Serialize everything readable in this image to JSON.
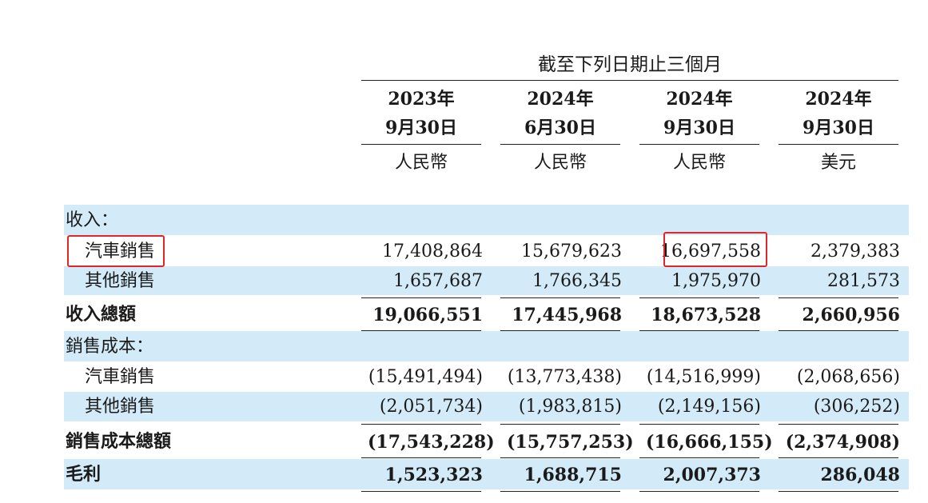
{
  "header": {
    "period_title": "截至下列日期止三個月",
    "columns": [
      {
        "year": "2023年",
        "date": "9月30日",
        "currency": "人民幣"
      },
      {
        "year": "2024年",
        "date": "6月30日",
        "currency": "人民幣"
      },
      {
        "year": "2024年",
        "date": "9月30日",
        "currency": "人民幣"
      },
      {
        "year": "2024年",
        "date": "9月30日",
        "currency": "美元"
      }
    ]
  },
  "rows": {
    "revenue_heading": {
      "label": "收入："
    },
    "vehicle_sales": {
      "label": "汽車銷售",
      "values": [
        "17,408,864",
        "15,679,623",
        "16,697,558",
        "2,379,383"
      ]
    },
    "other_sales": {
      "label": "其他銷售",
      "values": [
        "1,657,687",
        "1,766,345",
        "1,975,970",
        "281,573"
      ]
    },
    "total_revenue": {
      "label": "收入總額",
      "values": [
        "19,066,551",
        "17,445,968",
        "18,673,528",
        "2,660,956"
      ]
    },
    "cost_heading": {
      "label": "銷售成本："
    },
    "cost_vehicle": {
      "label": "汽車銷售",
      "values": [
        "(15,491,494)",
        "(13,773,438)",
        "(14,516,999)",
        "(2,068,656)"
      ]
    },
    "cost_other": {
      "label": "其他銷售",
      "values": [
        "(2,051,734)",
        "(1,983,815)",
        "(2,149,156)",
        "(306,252)"
      ]
    },
    "total_cost": {
      "label": "銷售成本總額",
      "values": [
        "(17,543,228)",
        "(15,757,253)",
        "(16,666,155)",
        "(2,374,908)"
      ]
    },
    "gross_profit": {
      "label": "毛利",
      "values": [
        "1,523,323",
        "1,688,715",
        "2,007,373",
        "286,048"
      ]
    }
  },
  "colors": {
    "band": "#d3ebf8",
    "highlight": "#e0252b"
  }
}
